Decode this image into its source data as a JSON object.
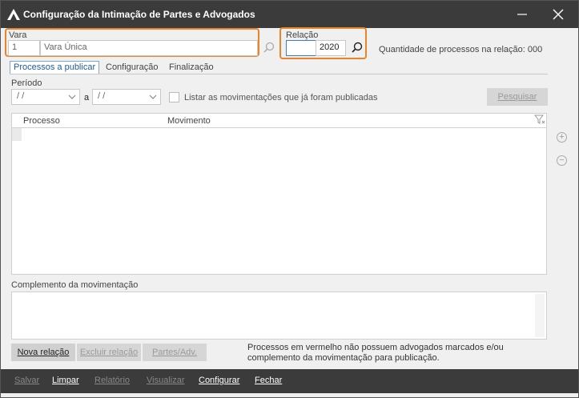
{
  "window": {
    "title": "Configuração da Intimação de Partes e Advogados",
    "minimize_symbol": "—",
    "close_symbol": "✕"
  },
  "vara": {
    "label": "Vara",
    "code": "1",
    "name": "Vara Única"
  },
  "relacao": {
    "label": "Relação",
    "number": "",
    "year": "2020",
    "quantity_text": "Quantidade de processos na relação: 000"
  },
  "tabs": [
    {
      "label": "Processos a publicar",
      "active": true
    },
    {
      "label": "Configuração",
      "active": false
    },
    {
      "label": "Finalização",
      "active": false
    }
  ],
  "periodo": {
    "label": "Período",
    "from": "/ /",
    "separator": "a",
    "to": "/ /",
    "checkbox_label": "Listar as movimentações que já foram publicadas",
    "search_button": "Pesquisar"
  },
  "grid": {
    "columns": [
      "Processo",
      "Movimento"
    ]
  },
  "complemento": {
    "label": "Complemento da movimentação"
  },
  "actions": {
    "nova_relacao": "Nova relação",
    "excluir_relacao": "Excluir relação",
    "partes_adv": "Partes/Adv.",
    "info_text_line1": "Processos em vermelho não possuem advogados marcados e/ou",
    "info_text_line2": "complemento da movimentação para publicação."
  },
  "bottom_menu": {
    "salvar": "Salvar",
    "limpar": "Limpar",
    "relatorio": "Relatório",
    "visualizar": "Visualizar",
    "configurar": "Configurar",
    "fechar": "Fechar"
  },
  "colors": {
    "titlebar": "#3b3b3b",
    "highlight": "#e8852a",
    "active_tab": "#1a5da8"
  }
}
